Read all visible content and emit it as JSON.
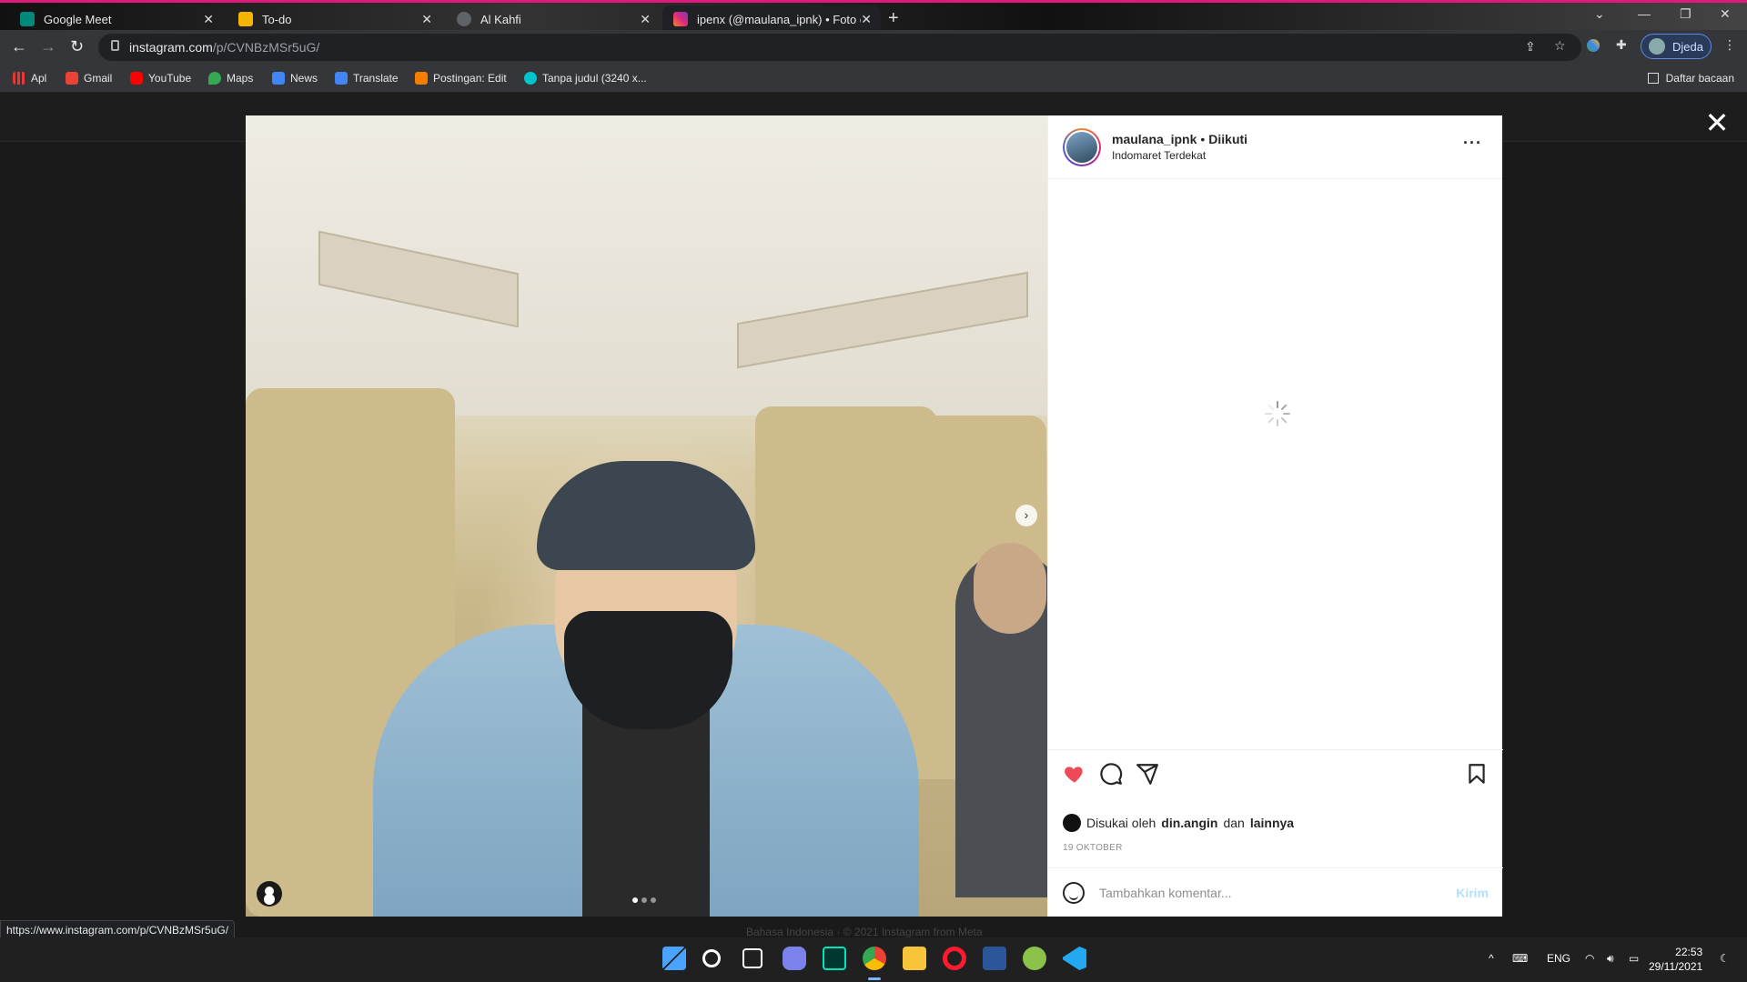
{
  "browser": {
    "tabs": [
      {
        "title": "Google Meet",
        "color": "#00897b"
      },
      {
        "title": "To-do",
        "color": "#f4b400"
      },
      {
        "title": "Al Kahfi",
        "color": "#5f6368"
      },
      {
        "title": "ipenx (@maulana_ipnk) • Foto da",
        "color": "#dd2a7b",
        "active": true
      }
    ],
    "url_host": "instagram.com",
    "url_path": "/p/CVNBzMSr5uG/",
    "profile_label": "Djeda",
    "bookmarks": [
      {
        "label": "Apl",
        "icon": "apps-grid-icon",
        "color": "#e53935"
      },
      {
        "label": "Gmail",
        "icon": "gmail-icon",
        "color": "#ea4335"
      },
      {
        "label": "YouTube",
        "icon": "youtube-icon",
        "color": "#ff0000"
      },
      {
        "label": "Maps",
        "icon": "maps-icon",
        "color": "#34a853"
      },
      {
        "label": "News",
        "icon": "news-icon",
        "color": "#4285f4"
      },
      {
        "label": "Translate",
        "icon": "translate-icon",
        "color": "#4285f4"
      },
      {
        "label": "Postingan: Edit",
        "icon": "blogger-icon",
        "color": "#f57d00"
      },
      {
        "label": "Tanpa judul (3240 x...",
        "icon": "canva-icon",
        "color": "#00c4cc"
      }
    ],
    "reading_list": "Daftar bacaan",
    "status_url": "https://www.instagram.com/p/CVNBzMSr5uG/"
  },
  "post": {
    "username": "maulana_ipnk",
    "follow_state": "Diikuti",
    "location": "Indomaret Terdekat",
    "liked_by_prefix": "Disukai oleh",
    "liked_by_user": "din.angin",
    "liked_by_and": "dan",
    "liked_by_others": "lainnya",
    "date": "19 OKTOBER",
    "comment_placeholder": "Tambahkan komentar...",
    "post_button": "Kirim",
    "liked": true,
    "carousel_count": 3,
    "carousel_index": 1,
    "heart_color": "#ed4956"
  },
  "page_footer": "Bahasa Indonesia  ·  © 2021 Instagram from Meta",
  "taskbar": {
    "lang": "ENG",
    "time": "22:53",
    "date": "29/11/2021",
    "apps": [
      {
        "name": "start-icon",
        "color": "#4aa3ff"
      },
      {
        "name": "search-icon",
        "color": "#ffffff"
      },
      {
        "name": "task-view-icon",
        "color": "#ffffff"
      },
      {
        "name": "teams-chat-icon",
        "color": "#7b83eb"
      },
      {
        "name": "audition-icon",
        "color": "#00e4bb"
      },
      {
        "name": "chrome-icon",
        "color": "#fbbc04"
      },
      {
        "name": "file-explorer-icon",
        "color": "#f8c53a"
      },
      {
        "name": "opera-icon",
        "color": "#ff1b2d"
      },
      {
        "name": "word-icon",
        "color": "#2b579a"
      },
      {
        "name": "money-app-icon",
        "color": "#8bc34a"
      },
      {
        "name": "vscode-icon",
        "color": "#23a9f2"
      }
    ]
  }
}
